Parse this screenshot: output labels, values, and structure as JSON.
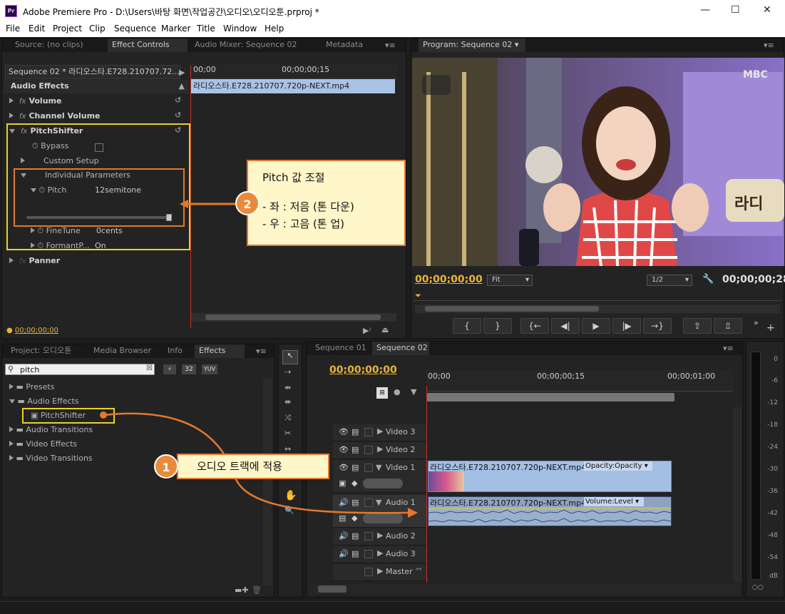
{
  "app": {
    "title": "Adobe Premiere Pro - D:\\Users\\바탕 화면\\작업공간\\오디오\\오디오툰.prproj *"
  },
  "menu": [
    "File",
    "Edit",
    "Project",
    "Clip",
    "Sequence",
    "Marker",
    "Title",
    "Window",
    "Help"
  ],
  "top_left": {
    "tabs": [
      "Source: (no clips)",
      "Effect Controls",
      "Audio Mixer: Sequence 02",
      "Metadata"
    ],
    "seq_label": "Sequence 02 * 라디오스타.E728.210707.72...",
    "ruler": [
      "00;00",
      "00;00;00;15"
    ],
    "clip_name": "라디오스타.E728.210707.720p-NEXT.mp4",
    "section": "Audio Effects",
    "effects": {
      "volume": "Volume",
      "channel_volume": "Channel Volume",
      "pitchshifter": "PitchShifter",
      "bypass": "Bypass",
      "custom_setup": "Custom Setup",
      "individual": "Individual Parameters",
      "pitch": "Pitch",
      "pitch_value": "12semitone",
      "finetune": "FineTune",
      "finetune_value": "0cents",
      "formant": "FormantP...",
      "formant_value": "On",
      "panner": "Panner"
    },
    "timecode": "00;00;00;00"
  },
  "program": {
    "tab": "Program: Sequence 02",
    "timecode_left": "00;00;00;00",
    "fit": "Fit",
    "ratio": "1/2",
    "timecode_right": "00;00;00;28",
    "logo": "MBC"
  },
  "callout2": {
    "num": "2",
    "title": "Pitch 값 조절",
    "line1": "- 좌 : 저음 (톤 다운)",
    "line2": "- 우 : 고음 (톤 업)"
  },
  "callout1": {
    "num": "1",
    "text": "오디오 트랙에 적용"
  },
  "bottom_left": {
    "tabs": [
      "Project: 오디오툰",
      "Media Browser",
      "Info",
      "Effects"
    ],
    "search": "pitch",
    "badges": [
      "32",
      "YUV"
    ],
    "tree": [
      "Presets",
      "Audio Effects",
      "PitchShifter",
      "Audio Transitions",
      "Video Effects",
      "Video Transitions"
    ]
  },
  "timeline": {
    "tabs": [
      "Sequence 01",
      "Sequence 02"
    ],
    "timecode": "00;00;00;00",
    "ruler": [
      "00;00",
      "00;00;00;15",
      "00;00;01;00"
    ],
    "tracks": {
      "video3": "Video 3",
      "video2": "Video 2",
      "video1": "Video 1",
      "audio1": "Audio 1",
      "audio2": "Audio 2",
      "audio3": "Audio 3",
      "master": "Master"
    },
    "video_clip": "라디오스타.E728.210707.720p-NEXT.mp4",
    "video_fx": "Opacity:Opacity",
    "audio_clip": "라디오스타.E728.210707.720p-NEXT.mp4",
    "audio_fx": "Volume:Level"
  },
  "meter": {
    "labels": [
      "0",
      "-6",
      "-12",
      "-18",
      "-24",
      "-30",
      "-36",
      "-42",
      "-48",
      "-54",
      "dB"
    ]
  }
}
